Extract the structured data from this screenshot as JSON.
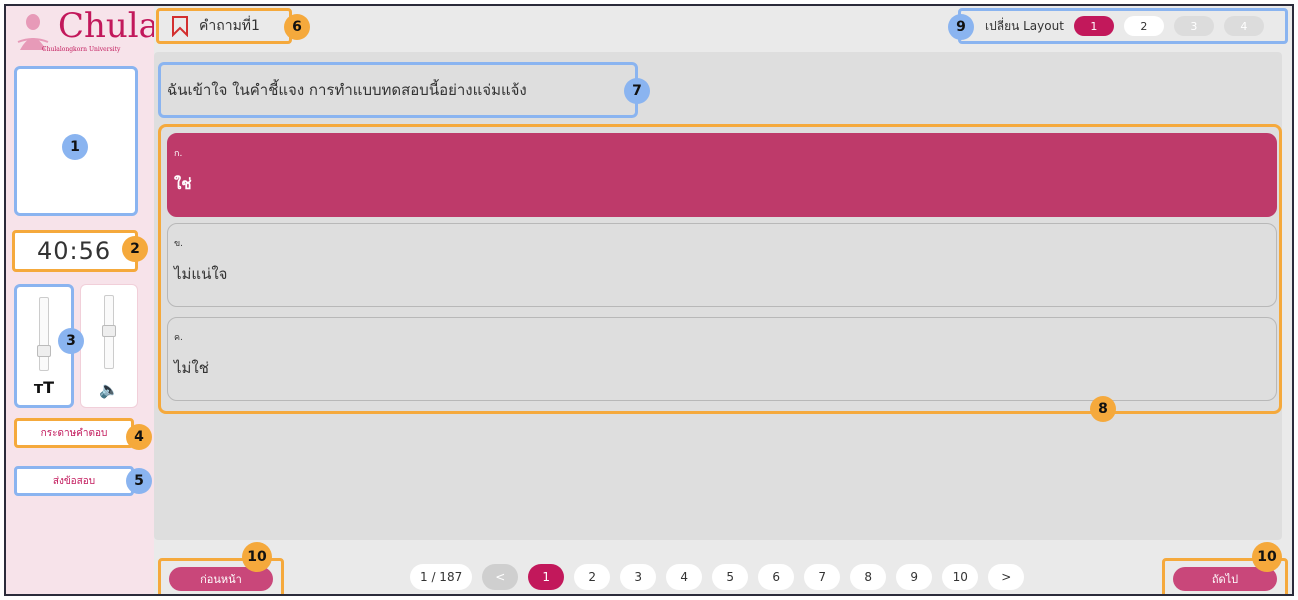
{
  "sidebar": {
    "logo_text": "Chula",
    "logo_sub": "Chulalongkorn University",
    "timer": "40:56",
    "text_size_icon": "тT",
    "volume_icon": "🔈",
    "answer_sheet_label": "กระดาษคำตอบ",
    "submit_label": "ส่งข้อสอบ"
  },
  "header": {
    "question_title": "คำถามที่1",
    "layout_label": "เปลี่ยน Layout",
    "layout_options": [
      "1",
      "2",
      "3",
      "4"
    ]
  },
  "question": {
    "text": "ฉันเข้าใจ ในคำชี้แจง การทำแบบทดสอบนี้อย่างแจ่มแจ้ง",
    "choices": [
      {
        "letter": "ก.",
        "text": "ใช่"
      },
      {
        "letter": "ข.",
        "text": "ไม่แน่ใจ"
      },
      {
        "letter": "ค.",
        "text": "ไม่ใช่"
      }
    ]
  },
  "footer": {
    "prev_label": "ก่อนหน้า",
    "next_label": "ถัดไป",
    "page_count": "1 / 187",
    "prev_page": "<",
    "next_page": ">",
    "pages": [
      "1",
      "2",
      "3",
      "4",
      "5",
      "6",
      "7",
      "8",
      "9",
      "10"
    ]
  },
  "badges": [
    "1",
    "2",
    "3",
    "4",
    "5",
    "6",
    "7",
    "8",
    "9",
    "10",
    "10"
  ],
  "colors": {
    "accent": "#c2185b",
    "selected_choice": "#be3a6a",
    "sidebar_bg": "#f7e3ea",
    "highlight_blue": "#8ab4f0",
    "highlight_orange": "#f5a93c"
  }
}
